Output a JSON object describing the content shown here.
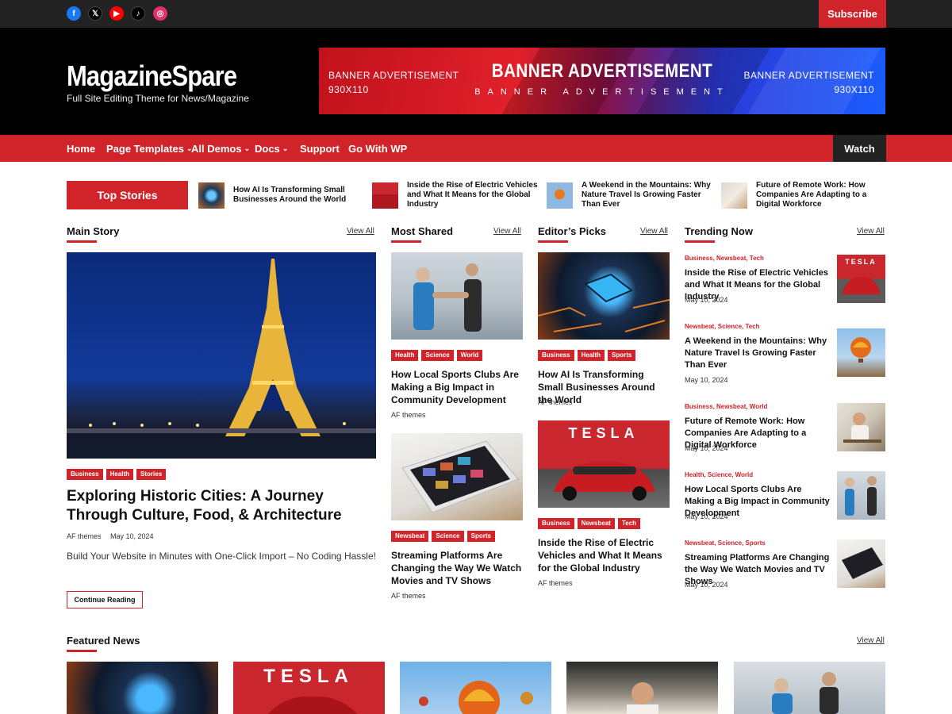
{
  "topbar": {
    "social": [
      "facebook-icon",
      "x-icon",
      "youtube-icon",
      "tiktok-icon",
      "instagram-icon"
    ],
    "subscribe_label": "Subscribe"
  },
  "header": {
    "site_title": "MagazineSpare",
    "tagline": "Full Site Editing Theme for News/Magazine",
    "banner": {
      "left_line1": "BANNER ADVERTISEMENT",
      "left_line2": "930X110",
      "center": "BANNER ADVERTISEMENT",
      "center_sub": "BANNER ADVERTISEMENT",
      "right_line1": "BANNER ADVERTISEMENT",
      "right_line2": "930X110"
    }
  },
  "nav": {
    "items": [
      {
        "label": "Home"
      },
      {
        "label": "Page Templates"
      },
      {
        "label": "All Demos"
      },
      {
        "label": "Docs"
      },
      {
        "label": "Support"
      },
      {
        "label": "Go With WP"
      }
    ],
    "watch_label": "Watch"
  },
  "top_stories": {
    "label": "Top Stories",
    "items": [
      {
        "title": "How AI Is Transforming Small Businesses Around the World"
      },
      {
        "title": "Inside the Rise of Electric Vehicles and What It Means for the Global Industry"
      },
      {
        "title": "A Weekend in the Mountains: Why Nature Travel Is Growing Faster Than Ever"
      },
      {
        "title": "Future of Remote Work: How Companies Are Adapting to a Digital Workforce"
      }
    ]
  },
  "main_story": {
    "section_title": "Main Story",
    "view_all": "View All",
    "tags": [
      "Business",
      "Health",
      "Stories"
    ],
    "title": "Exploring Historic Cities: A Journey Through Culture, Food, & Architecture",
    "author": "AF themes",
    "date": "May 10, 2024",
    "excerpt": "Build Your Website in Minutes with One-Click Import – No Coding Hassle!",
    "button": "Continue Reading"
  },
  "most_shared": {
    "section_title": "Most Shared",
    "view_all": "View All",
    "cards": [
      {
        "tags": [
          "Health",
          "Science",
          "World"
        ],
        "title": "How Local Sports Clubs Are Making a Big Impact in Community Development",
        "author": "AF themes"
      },
      {
        "tags": [
          "Newsbeat",
          "Science",
          "Sports"
        ],
        "title": "Streaming Platforms Are Changing the Way We Watch Movies and TV Shows",
        "author": "AF themes"
      }
    ]
  },
  "editors_picks": {
    "section_title": "Editor’s Picks",
    "view_all": "View All",
    "cards": [
      {
        "tags": [
          "Business",
          "Health",
          "Sports"
        ],
        "title": "How AI Is Transforming Small Businesses Around the World",
        "author": "AF themes"
      },
      {
        "tags": [
          "Business",
          "Newsbeat",
          "Tech"
        ],
        "title": "Inside the Rise of Electric Vehicles and What It Means for the Global Industry",
        "author": "AF themes"
      }
    ]
  },
  "trending": {
    "section_title": "Trending Now",
    "view_all": "View All",
    "items": [
      {
        "cats": "Business, Newsbeat, Tech",
        "title": "Inside the Rise of Electric Vehicles and What It Means for the Global Industry",
        "date": "May 10, 2024"
      },
      {
        "cats": "Newsbeat, Science, Tech",
        "title": "A Weekend in the Mountains: Why Nature Travel Is Growing Faster Than Ever",
        "date": "May 10, 2024"
      },
      {
        "cats": "Business, Newsbeat, World",
        "title": "Future of Remote Work: How Companies Are Adapting to a Digital Workforce",
        "date": "May 10, 2024"
      },
      {
        "cats": "Health, Science, World",
        "title": "How Local Sports Clubs Are Making a Big Impact in Community Development",
        "date": "May 10, 2024"
      },
      {
        "cats": "Newsbeat, Science, Sports",
        "title": "Streaming Platforms Are Changing the Way We Watch Movies and TV Shows",
        "date": "May 10, 2024"
      }
    ]
  },
  "featured": {
    "section_title": "Featured News",
    "view_all": "View All"
  },
  "colors": {
    "accent": "#d0232a",
    "dark": "#222222",
    "header_bg": "#000000"
  }
}
